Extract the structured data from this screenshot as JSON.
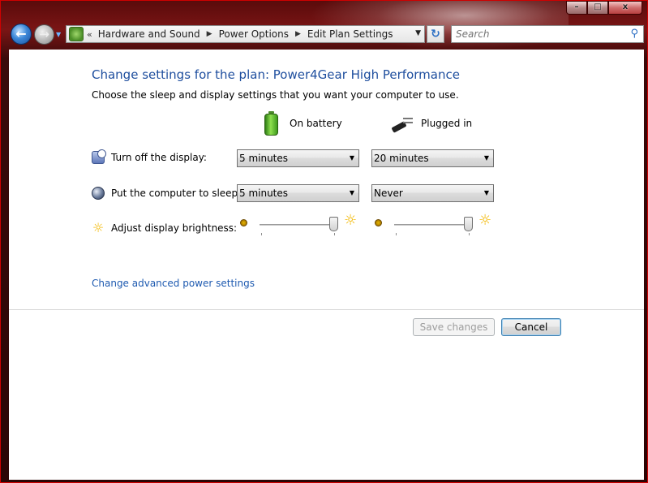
{
  "nav": {
    "breadcrumb": [
      "Hardware and Sound",
      "Power Options",
      "Edit Plan Settings"
    ],
    "lead": "«",
    "search_placeholder": "Search"
  },
  "caption": {
    "min": "–",
    "max": "□",
    "close": "x"
  },
  "page": {
    "title": "Change settings for the plan: Power4Gear High Performance",
    "subtitle": "Choose the sleep and display settings that you want your computer to use."
  },
  "columns": {
    "battery_label": "On battery",
    "plugged_label": "Plugged in"
  },
  "settings": {
    "display": {
      "label": "Turn off the display:",
      "on_battery": "5 minutes",
      "plugged_in": "20 minutes"
    },
    "sleep": {
      "label": "Put the computer to sleep:",
      "on_battery": "5 minutes",
      "plugged_in": "Never"
    },
    "brightness": {
      "label": "Adjust display brightness:",
      "on_battery_level": 1.0,
      "plugged_in_level": 1.0
    }
  },
  "links": {
    "advanced": "Change advanced power settings"
  },
  "buttons": {
    "save": "Save changes",
    "cancel": "Cancel"
  },
  "colors": {
    "frame": "#5a0b0b",
    "title": "#1e4e9e",
    "link": "#1e5ab0",
    "accent_border": "#d00000"
  },
  "icons": {
    "back": "back-arrow-icon",
    "forward": "forward-arrow-icon",
    "refresh": "refresh-icon",
    "search": "magnifier-icon",
    "battery": "battery-icon",
    "plug": "plug-icon",
    "display": "display-clock-icon",
    "sleep": "moon-icon",
    "brightness": "sun-icon"
  }
}
